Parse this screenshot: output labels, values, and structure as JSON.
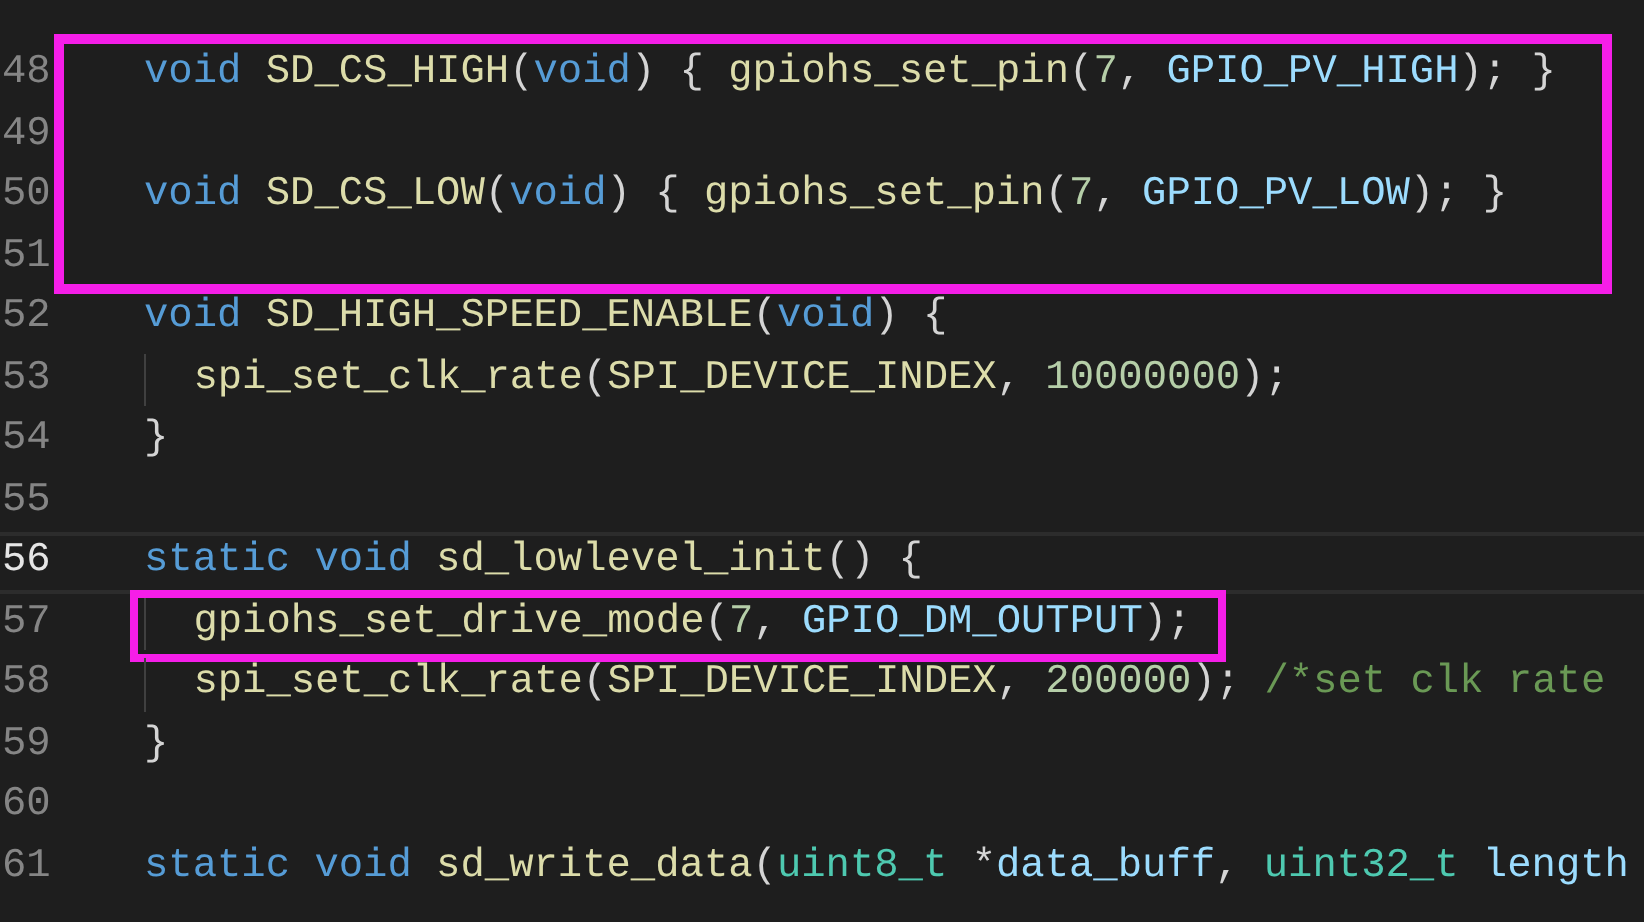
{
  "editor": {
    "segments": [
      {
        "kind": "block",
        "lines": [
          {
            "number": "48",
            "current": false,
            "indented": false,
            "tokens": [
              {
                "text": "void",
                "kind": "keyword"
              },
              {
                "text": " SD_CS_HIGH",
                "kind": "function"
              },
              {
                "text": "(",
                "kind": "plain"
              },
              {
                "text": "void",
                "kind": "keyword"
              },
              {
                "text": ") { ",
                "kind": "plain"
              },
              {
                "text": "gpiohs_set_pin",
                "kind": "function"
              },
              {
                "text": "(",
                "kind": "plain"
              },
              {
                "text": "7",
                "kind": "number"
              },
              {
                "text": ", ",
                "kind": "plain"
              },
              {
                "text": "GPIO_PV_HIGH",
                "kind": "macro"
              },
              {
                "text": "); }",
                "kind": "plain"
              }
            ]
          },
          {
            "number": "49",
            "current": false
          },
          {
            "number": "50",
            "current": false,
            "indented": false,
            "tokens": [
              {
                "text": "void",
                "kind": "keyword"
              },
              {
                "text": " SD_CS_LOW",
                "kind": "function"
              },
              {
                "text": "(",
                "kind": "plain"
              },
              {
                "text": "void",
                "kind": "keyword"
              },
              {
                "text": ") { ",
                "kind": "plain"
              },
              {
                "text": "gpiohs_set_pin",
                "kind": "function"
              },
              {
                "text": "(",
                "kind": "plain"
              },
              {
                "text": "7",
                "kind": "number"
              },
              {
                "text": ", ",
                "kind": "plain"
              },
              {
                "text": "GPIO_PV_LOW",
                "kind": "macro"
              },
              {
                "text": "); }",
                "kind": "plain"
              }
            ]
          },
          {
            "number": "51",
            "current": false
          }
        ]
      },
      {
        "kind": "none",
        "lines": [
          {
            "number": "52",
            "current": false,
            "indented": false,
            "tokens": [
              {
                "text": "void",
                "kind": "keyword"
              },
              {
                "text": " SD_HIGH_SPEED_ENABLE",
                "kind": "function"
              },
              {
                "text": "(",
                "kind": "plain"
              },
              {
                "text": "void",
                "kind": "keyword"
              },
              {
                "text": ") {",
                "kind": "plain"
              }
            ]
          },
          {
            "number": "53",
            "current": false,
            "indented": true,
            "tokens": [
              {
                "text": "spi_set_clk_rate",
                "kind": "function"
              },
              {
                "text": "(",
                "kind": "plain"
              },
              {
                "text": "SPI_DEVICE_INDEX",
                "kind": "function"
              },
              {
                "text": ", ",
                "kind": "plain"
              },
              {
                "text": "10000000",
                "kind": "number"
              },
              {
                "text": ");",
                "kind": "plain"
              }
            ]
          },
          {
            "number": "54",
            "current": false,
            "indented": false,
            "tokens": [
              {
                "text": "}",
                "kind": "plain"
              }
            ]
          },
          {
            "number": "55",
            "current": false
          },
          {
            "number": "56",
            "current": true,
            "indented": false,
            "tokens": [
              {
                "text": "static void",
                "kind": "keyword"
              },
              {
                "text": " sd_lowlevel_init",
                "kind": "function"
              },
              {
                "text": "() {",
                "kind": "plain"
              }
            ]
          }
        ]
      },
      {
        "kind": "line",
        "lines": [
          {
            "number": "57",
            "current": false,
            "indented": true,
            "tokens": [
              {
                "text": "gpiohs_set_drive_mode",
                "kind": "function"
              },
              {
                "text": "(",
                "kind": "plain"
              },
              {
                "text": "7",
                "kind": "number"
              },
              {
                "text": ", ",
                "kind": "plain"
              },
              {
                "text": "GPIO_DM_OUTPUT",
                "kind": "macro"
              },
              {
                "text": ");",
                "kind": "plain"
              }
            ]
          }
        ]
      },
      {
        "kind": "none",
        "lines": [
          {
            "number": "58",
            "current": false,
            "indented": true,
            "tokens": [
              {
                "text": "spi_set_clk_rate",
                "kind": "function"
              },
              {
                "text": "(",
                "kind": "plain"
              },
              {
                "text": "SPI_DEVICE_INDEX",
                "kind": "function"
              },
              {
                "text": ", ",
                "kind": "plain"
              },
              {
                "text": "200000",
                "kind": "number"
              },
              {
                "text": "); ",
                "kind": "plain"
              },
              {
                "text": "/*set clk rate",
                "kind": "comment"
              }
            ]
          },
          {
            "number": "59",
            "current": false,
            "indented": false,
            "tokens": [
              {
                "text": "}",
                "kind": "plain"
              }
            ]
          },
          {
            "number": "60",
            "current": false
          },
          {
            "number": "61",
            "current": false,
            "indented": false,
            "tokens": [
              {
                "text": "static void",
                "kind": "keyword"
              },
              {
                "text": " sd_write_data",
                "kind": "function"
              },
              {
                "text": "(",
                "kind": "plain"
              },
              {
                "text": "uint8_t",
                "kind": "type"
              },
              {
                "text": " *",
                "kind": "plain"
              },
              {
                "text": "data_buff",
                "kind": "param"
              },
              {
                "text": ", ",
                "kind": "plain"
              },
              {
                "text": "uint32_t",
                "kind": "type"
              },
              {
                "text": " length",
                "kind": "param"
              }
            ]
          }
        ]
      }
    ]
  }
}
